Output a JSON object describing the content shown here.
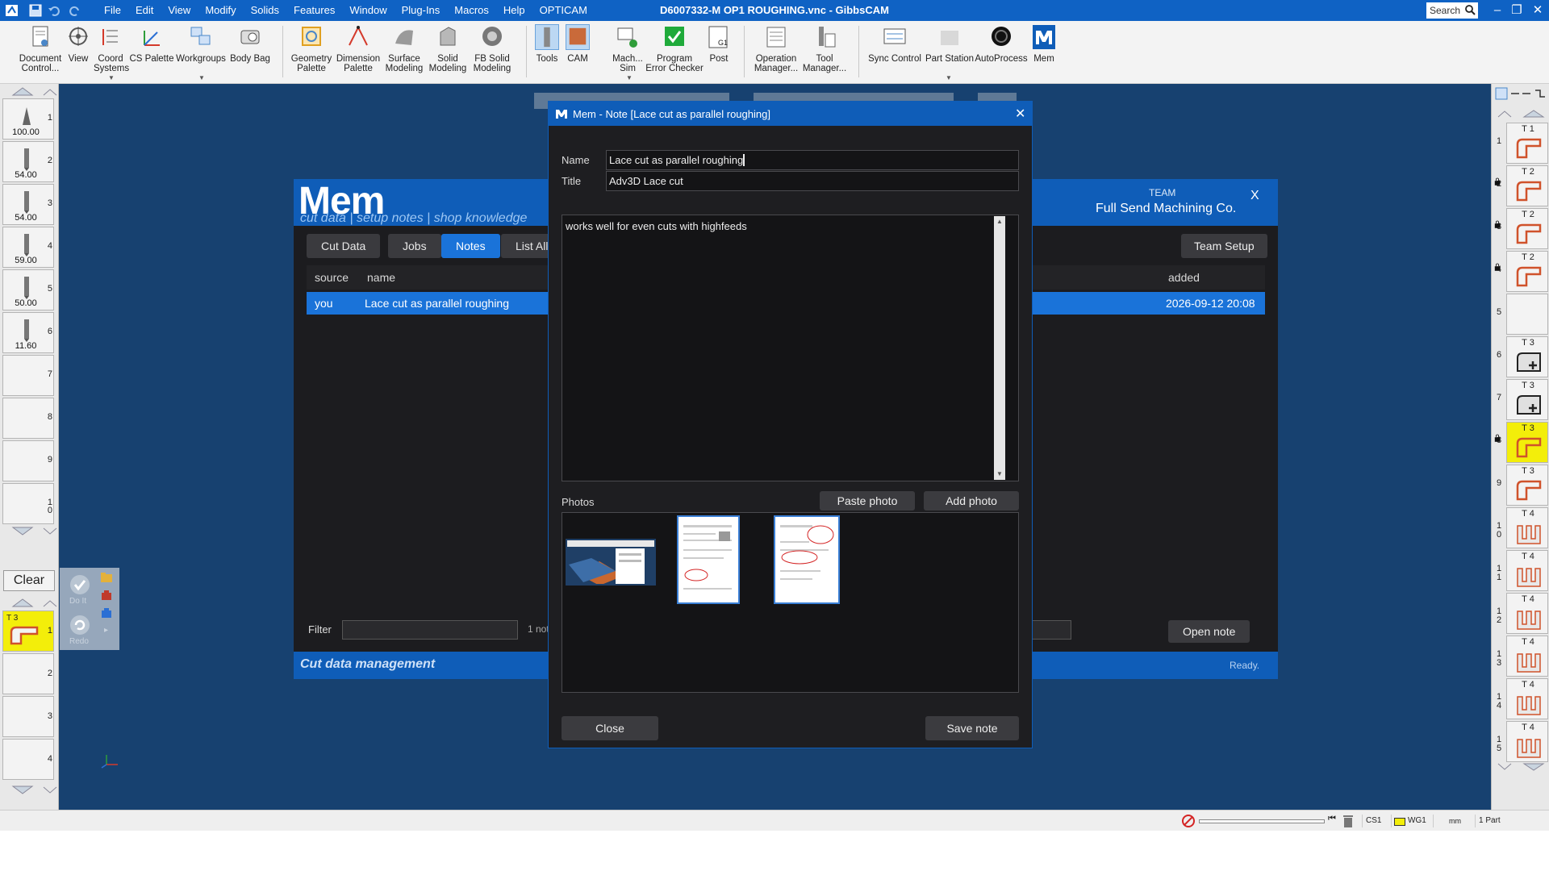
{
  "window": {
    "title": "D6007332-M OP1 ROUGHING.vnc - GibbsCAM",
    "menu": [
      "File",
      "Edit",
      "View",
      "Modify",
      "Solids",
      "Features",
      "Window",
      "Plug-Ins",
      "Macros",
      "Help",
      "OPTICAM"
    ],
    "search_placeholder": "Search"
  },
  "toolbar": {
    "items": [
      {
        "label1": "Document",
        "label2": "Control...",
        "icon": "document-icon"
      },
      {
        "label1": "View",
        "label2": "",
        "icon": "view-icon"
      },
      {
        "label1": "Coord",
        "label2": "Systems",
        "icon": "coord-systems-icon"
      },
      {
        "label1": "CS Palette",
        "label2": "",
        "icon": "cs-palette-icon"
      },
      {
        "label1": "Workgroups",
        "label2": "",
        "icon": "workgroups-icon"
      },
      {
        "label1": "Body Bag",
        "label2": "",
        "icon": "body-bag-icon"
      },
      {
        "label1": "Geometry",
        "label2": "Palette",
        "icon": "geometry-palette-icon"
      },
      {
        "label1": "Dimension",
        "label2": "Palette",
        "icon": "dimension-palette-icon"
      },
      {
        "label1": "Surface",
        "label2": "Modeling",
        "icon": "surface-modeling-icon"
      },
      {
        "label1": "Solid",
        "label2": "Modeling",
        "icon": "solid-modeling-icon"
      },
      {
        "label1": "FB Solid",
        "label2": "Modeling",
        "icon": "fb-solid-modeling-icon"
      },
      {
        "label1": "Tools",
        "label2": "",
        "icon": "tools-icon"
      },
      {
        "label1": "CAM",
        "label2": "",
        "icon": "cam-icon"
      },
      {
        "label1": "Mach...",
        "label2": "Sim",
        "icon": "machine-sim-icon"
      },
      {
        "label1": "Program",
        "label2": "Error Checker",
        "icon": "check-icon"
      },
      {
        "label1": "Post",
        "label2": "",
        "icon": "post-icon"
      },
      {
        "label1": "Operation",
        "label2": "Manager...",
        "icon": "operation-manager-icon"
      },
      {
        "label1": "Tool",
        "label2": "Manager...",
        "icon": "tool-manager-icon"
      },
      {
        "label1": "Sync Control",
        "label2": "",
        "icon": "sync-control-icon"
      },
      {
        "label1": "Part Station",
        "label2": "",
        "icon": "part-station-icon"
      },
      {
        "label1": "AutoProcess",
        "label2": "",
        "icon": "autoprocess-icon"
      },
      {
        "label1": "Mem",
        "label2": "",
        "icon": "mem-icon"
      }
    ]
  },
  "left_tools": [
    {
      "num": "1",
      "value": "100.00"
    },
    {
      "num": "2",
      "value": "54.00"
    },
    {
      "num": "3",
      "value": "54.00"
    },
    {
      "num": "4",
      "value": "59.00"
    },
    {
      "num": "5",
      "value": "50.00"
    },
    {
      "num": "6",
      "value": "11.60"
    },
    {
      "num": "7",
      "value": ""
    },
    {
      "num": "8",
      "value": ""
    },
    {
      "num": "9",
      "value": ""
    },
    {
      "num": "1\n0",
      "value": ""
    }
  ],
  "left_ops": {
    "clear_label": "Clear",
    "do_it_label": "Do It",
    "redo_label": "Redo",
    "rows": [
      {
        "num": "1",
        "tag": "T 3"
      },
      {
        "num": "2",
        "tag": ""
      },
      {
        "num": "3",
        "tag": ""
      },
      {
        "num": "4",
        "tag": ""
      }
    ]
  },
  "right_tools": [
    {
      "num": "1",
      "tlabel": "T 1"
    },
    {
      "num": "2",
      "tlabel": "T 2"
    },
    {
      "num": "3",
      "tlabel": "T 2"
    },
    {
      "num": "4",
      "tlabel": "T 2"
    },
    {
      "num": "5",
      "tlabel": ""
    },
    {
      "num": "6",
      "tlabel": "T 3"
    },
    {
      "num": "7",
      "tlabel": "T 3"
    },
    {
      "num": "8",
      "tlabel": "T 3"
    },
    {
      "num": "9",
      "tlabel": "T 3"
    },
    {
      "num": "1\n0",
      "tlabel": "T 4"
    },
    {
      "num": "1\n1",
      "tlabel": "T 4"
    },
    {
      "num": "1\n2",
      "tlabel": "T 4"
    },
    {
      "num": "1\n3",
      "tlabel": "T 4"
    },
    {
      "num": "1\n4",
      "tlabel": "T 4"
    },
    {
      "num": "1\n5",
      "tlabel": "T 4"
    }
  ],
  "statusbar": {
    "cs": "CS1",
    "wg": "WG1",
    "unit": "mm",
    "parts": "1 Part"
  },
  "mem": {
    "logo": "Mem",
    "tagline": "cut data | setup notes | shop knowledge",
    "team_label": "TEAM",
    "team_name": "Full Send Machining Co.",
    "close_x": "X",
    "tabs": [
      "Cut Data",
      "Jobs",
      "Notes",
      "List All"
    ],
    "active_tab": "Notes",
    "team_setup": "Team Setup",
    "columns": {
      "source": "source",
      "name": "name",
      "added": "added"
    },
    "row": {
      "source": "you",
      "name": "Lace cut as parallel roughing",
      "added": "2026-09-12 20:08"
    },
    "filter_label": "Filter",
    "count": "1 note",
    "open_note": "Open note",
    "footer_title": "Cut data management",
    "footer_status": "Ready."
  },
  "note_dialog": {
    "title": "Mem - Note [Lace cut as parallel roughing]",
    "name_label": "Name",
    "name_value": "Lace cut as parallel roughing",
    "title_label": "Title",
    "title_value": "Adv3D Lace cut",
    "body": "works well for even cuts with highfeeds",
    "photos_label": "Photos",
    "paste_photo": "Paste photo",
    "add_photo": "Add photo",
    "close": "Close",
    "save": "Save note"
  },
  "colors": {
    "title_bar": "#0f62c4",
    "workspace": "#174170",
    "accent": "#1a73d9",
    "dialog_bg": "#1e1e21",
    "active_tool": "#f3ee0a"
  }
}
